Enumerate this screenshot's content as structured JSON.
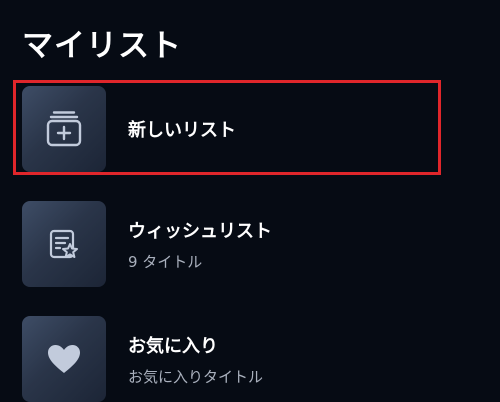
{
  "header": {
    "title": "マイリスト"
  },
  "lists": [
    {
      "title": "新しいリスト",
      "subtitle": "",
      "icon": "new-list-icon"
    },
    {
      "title": "ウィッシュリスト",
      "subtitle": "9 タイトル",
      "icon": "wishlist-star-icon"
    },
    {
      "title": "お気に入り",
      "subtitle": "お気に入りタイトル",
      "icon": "heart-icon"
    }
  ],
  "colors": {
    "background": "#060b14",
    "highlight": "#e0262b",
    "subtitle": "#a9b0bd"
  }
}
